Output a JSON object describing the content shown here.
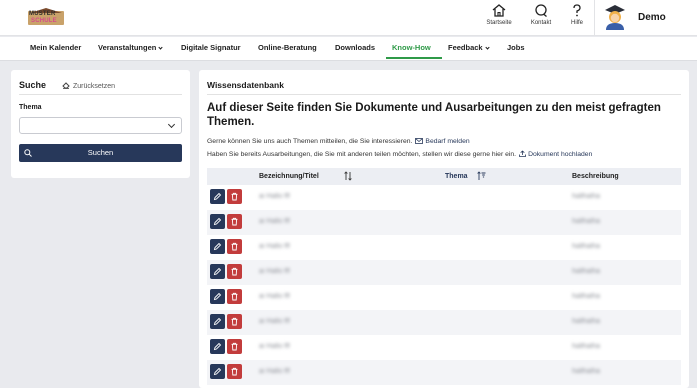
{
  "header": {
    "logo": {
      "line1": "MUSTER",
      "line2": "SCHULE"
    },
    "tools": [
      {
        "label": "Startseite",
        "icon": "home-icon"
      },
      {
        "label": "Kontakt",
        "icon": "contact-icon"
      },
      {
        "label": "Hilfe",
        "icon": "help-icon"
      }
    ],
    "user": {
      "name": "Demo",
      "avatar": "user-avatar-icon"
    }
  },
  "nav": {
    "items": [
      {
        "label": "Mein Kalender",
        "dropdown": false
      },
      {
        "label": "Veranstaltungen",
        "dropdown": true
      },
      {
        "label": "Digitale Signatur",
        "dropdown": false
      },
      {
        "label": "Online-Beratung",
        "dropdown": false
      },
      {
        "label": "Downloads",
        "dropdown": false
      },
      {
        "label": "Know-How",
        "dropdown": false,
        "active": true
      },
      {
        "label": "Feedback",
        "dropdown": true
      },
      {
        "label": "Jobs",
        "dropdown": false
      }
    ],
    "active_color": "#2f9a48"
  },
  "search": {
    "title": "Suche",
    "reset_label": "Zurücksetzen",
    "thema_label": "Thema",
    "thema_value": "",
    "button_label": "Suchen"
  },
  "main": {
    "title": "Wissensdatenbank",
    "heading": "Auf dieser Seite finden Sie Dokumente und Ausarbeitungen zu den meist gefragten Themen.",
    "info1_text": "Gerne können Sie uns auch Themen mitteilen, die Sie interessieren.",
    "info1_link": "Bedarf melden",
    "info2_text": "Haben Sie bereits Ausarbeitungen, die Sie mit anderen teilen möchten, stellen wir diese gerne hier ein.",
    "info2_link": "Dokument hochladen",
    "table": {
      "columns": [
        "Bezeichnung/Titel",
        "Thema",
        "Beschreibung"
      ],
      "rows": [
        {
          "title": "ai Hallo fff",
          "thema": "",
          "beschreibung": "hallhalha"
        },
        {
          "title": "ai Hallo fff",
          "thema": "",
          "beschreibung": "hallhalha"
        },
        {
          "title": "ai Hallo fff",
          "thema": "",
          "beschreibung": "hallhalha"
        },
        {
          "title": "ai Hallo fff",
          "thema": "",
          "beschreibung": "hallhalha"
        },
        {
          "title": "ai Hallo fff",
          "thema": "",
          "beschreibung": "hallhalha"
        },
        {
          "title": "ai Hallo fff",
          "thema": "",
          "beschreibung": "hallhalha"
        },
        {
          "title": "ai Hallo fff",
          "thema": "",
          "beschreibung": "hallhalha"
        },
        {
          "title": "ai Hallo fff",
          "thema": "",
          "beschreibung": "hallhalha"
        }
      ]
    }
  },
  "colors": {
    "primary": "#27385a",
    "danger": "#c23c3c",
    "background": "#e9eaee"
  }
}
